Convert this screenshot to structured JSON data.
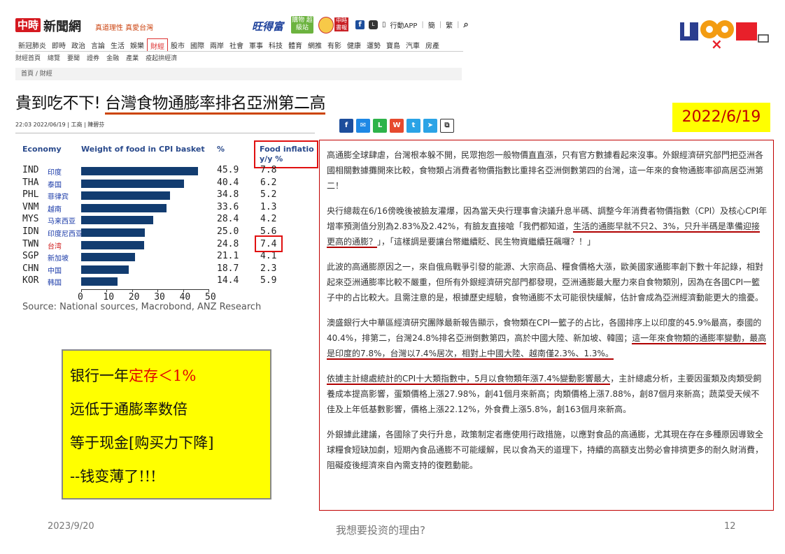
{
  "header": {
    "logo": "中時",
    "site_name": "新聞網",
    "slogan": "真道理性 真愛台灣",
    "partner": "旺得富",
    "shop": "購物 超級站",
    "badge": "中時 書報",
    "app_label": "行動APP",
    "lang_simplified": "簡",
    "lang_traditional": "繁"
  },
  "nav": {
    "main": [
      "新冠肺炎",
      "即時",
      "政治",
      "言論",
      "生活",
      "娛樂",
      "財經",
      "股市",
      "國際",
      "兩岸",
      "社會",
      "軍事",
      "科技",
      "體育",
      "網推",
      "有影",
      "健康",
      "運勢",
      "寶島",
      "汽車",
      "房產"
    ],
    "active": "財經",
    "sub": [
      "財經首頁",
      "總覽",
      "要聞",
      "證券",
      "金融",
      "產業",
      "疫起拚經濟"
    ]
  },
  "breadcrumb": "首頁 / 財經",
  "article_title": {
    "plain": "貴到吃不下! ",
    "underlined": "台灣食物通膨率排名亞洲第二高"
  },
  "meta": "22:03  2022/06/19  |  工商  |  陳碧芬",
  "slide_date": "2022/6/19",
  "share_icons": [
    "facebook-icon",
    "messenger-icon",
    "line-icon",
    "weibo-icon",
    "twitter-icon",
    "telegram-icon",
    "copy-icon"
  ],
  "chart_data": {
    "type": "bar",
    "headers": {
      "economy": "Economy",
      "weight": "Weight of food in CPI basket",
      "pct": "%",
      "inflation": "Food inflatio",
      "yy": "y/y %"
    },
    "rows": [
      {
        "code": "IND",
        "cn": "印度",
        "weight": 45.9,
        "weight_label": "45.9",
        "inflation": "7.8"
      },
      {
        "code": "THA",
        "cn": "泰国",
        "weight": 40.4,
        "weight_label": "40.4",
        "inflation": "6.2"
      },
      {
        "code": "PHL",
        "cn": "菲律宾",
        "weight": 34.8,
        "weight_label": "34.8",
        "inflation": "5.2"
      },
      {
        "code": "VNM",
        "cn": "越南",
        "weight": 33.6,
        "weight_label": "33.6",
        "inflation": "1.3"
      },
      {
        "code": "MYS",
        "cn": "马来西亚",
        "weight": 28.4,
        "weight_label": "28.4",
        "inflation": "4.2"
      },
      {
        "code": "IDN",
        "cn": "印度尼西亚",
        "weight": 25.0,
        "weight_label": "25.0",
        "inflation": "5.6"
      },
      {
        "code": "TWN",
        "cn": "台湾",
        "weight": 24.8,
        "weight_label": "24.8",
        "inflation": "7.4"
      },
      {
        "code": "SGP",
        "cn": "新加坡",
        "weight": 21.1,
        "weight_label": "21.1",
        "inflation": "4.1"
      },
      {
        "code": "CHN",
        "cn": "中国",
        "weight": 18.7,
        "weight_label": "18.7",
        "inflation": "2.3"
      },
      {
        "code": "KOR",
        "cn": "韩国",
        "weight": 14.4,
        "weight_label": "14.4",
        "inflation": "5.9"
      }
    ],
    "xticks": [
      "0",
      "10",
      "20",
      "30",
      "40",
      "50"
    ],
    "xlim": [
      0,
      50
    ],
    "source": "Source: National sources, Macrobond, ANZ Research"
  },
  "note": {
    "line1_a": "银行一年",
    "line1_b": "定存＜1%",
    "line2": "远低于通膨率数倍",
    "line3": "等于现金[购买力下降]",
    "line4": "--钱变薄了!!!"
  },
  "article": {
    "p1": "高通膨全球肆虐，台灣根本躲不開，民眾抱怨一般物價直直漲，只有官方數據看起來沒事。外銀經濟研究部門把亞洲各國相關數據攤開來比較，食物類占消費者物價指數比重排名亞洲倒數第四的台灣，這一年來的食物通膨率卻高居亞洲第二！",
    "p2a": "央行總裁在6/16傍晚後被臉友灌爆，因為當天央行理事會決議升息半碼、調整今年消費者物價指數（CPI）及核心CPI年增率預測值分別為2.83%及2.42%，有臉友直接嗆「我們都知道，",
    "p2b": "生活的通膨早就不只2、3%，只升半碼是準備迎接更高的通膨？",
    "p2c": "」，「這樣調是要讓台幣繼續貶、民生物資繼續狂飆囉？！」",
    "p3": "此波的高通膨原因之一，來自俄烏戰爭引發的能源、大宗商品、糧食價格大漲，歐美國家通膨率創下數十年記錄，相對起來亞洲通膨率比較不嚴重，但所有外銀經濟研究部門都發現，亞洲通膨最大壓力來自食物類別，因為在各國CPI一籃子中的占比較大。且需注意的是，根據歷史經驗，食物通膨不太可能很快緩解，估計會成為亞洲經濟動能更大的擔憂。",
    "p4a": "澳盛銀行大中華區經濟研究團隊最新報告顯示，食物類在CPI一籃子的占比，各國排序上以印度的45.9%最高，泰國的40.4%，排第二，台灣24.8%排名亞洲倒數第四，高於中國大陸、新加坡、韓國；",
    "p4b": "這一年來食物類的通膨率變動，最高是印度的7.8%，台灣以7.4%居次，相對上中國大陸、越南僅2.3%、1.3%。",
    "p5a": "依據主計總處統計的CPI十大類指數中，5月以食物類年漲7.4%變動影響最大",
    "p5b": "，主計總處分析，主要因蛋類及肉類受飼養成本提高影響，蛋類價格上漲27.98%，創41個月來新高；肉類價格上漲7.88%，創87個月來新高；蔬菜受天候不佳及上年低基數影響，價格上漲22.12%，外食費上漲5.8%，創163個月來新高。",
    "p6": "外銀據此建議，各國除了央行升息，政策制定者應使用行政措施，以應對食品的高通膨，尤其現在存在多種原因導致全球糧食短缺加劇，短期內食品通膨不可能緩解，民以食為天的道理下，持續的高額支出勢必會排擠更多的耐久財消費，阻礙疫後經濟來自內需支持的復甦動能。"
  },
  "footer": {
    "date": "2023/9/20",
    "title": "我想要投资的理由?",
    "page": "12"
  }
}
